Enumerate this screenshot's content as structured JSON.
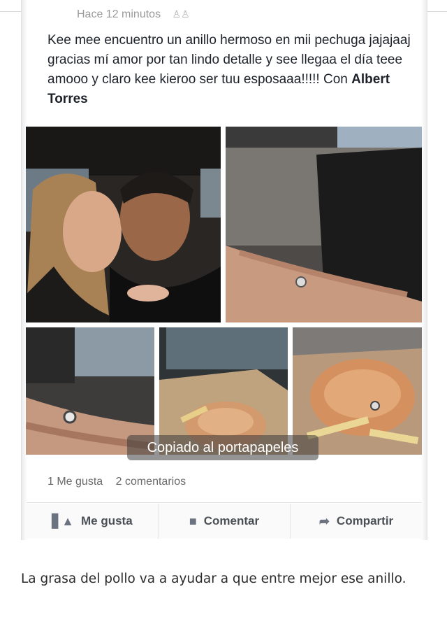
{
  "post": {
    "timestamp": "Hace 12 minutos",
    "text_main": "Kee mee encuentro un anillo hermoso en mii pechuga jajajaaj gracias mí amor por tan lindo detalle y see llegaa el día teee amooo y claro kee kieroo ser tuu esposaaa!!!!! Con ",
    "tagged_person": "Albert Torres",
    "stats": {
      "likes": "1 Me gusta",
      "comments": "2 comentarios"
    },
    "actions": {
      "like": "Me gusta",
      "comment": "Comentar",
      "share": "Compartir"
    }
  },
  "toast": "Copiado al portapapeles",
  "caption": "La grasa del pollo va a ayudar a que entre mejor ese anillo.",
  "icons": {
    "audience": "friends-icon",
    "like": "thumbs-up-icon",
    "comment": "speech-bubble-icon",
    "share": "share-arrow-icon"
  }
}
